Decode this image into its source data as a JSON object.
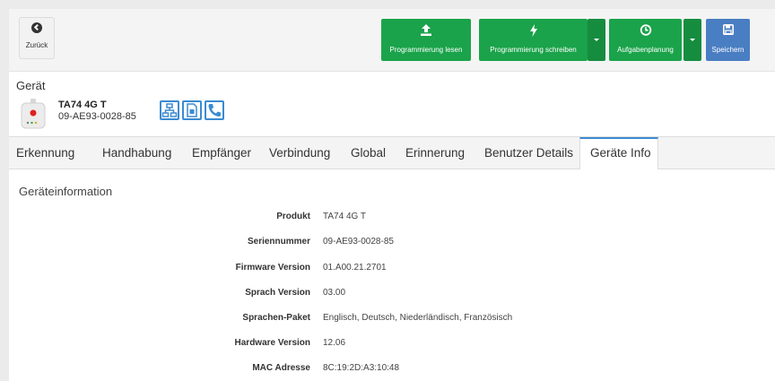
{
  "toolbar": {
    "back_label": "Zurück",
    "read_label": "Programmierung lesen",
    "write_label": "Programmierung schreiben",
    "schedule_label": "Aufgabenplanung",
    "save_label": "Speichern",
    "colors": {
      "green": "#1aa34a",
      "blue": "#4a7ec2"
    }
  },
  "device": {
    "heading": "Gerät",
    "name": "TA74 4G T",
    "serial": "09-AE93-0028-85",
    "icons": [
      "network-icon",
      "sim-card-icon",
      "phone-icon"
    ]
  },
  "tabs": [
    {
      "label": "Erkennung"
    },
    {
      "label": "Handhabung"
    },
    {
      "label": "Empfänger"
    },
    {
      "label": "Verbindung"
    },
    {
      "label": "Global"
    },
    {
      "label": "Erinnerung"
    },
    {
      "label": "Benutzer Details"
    },
    {
      "label": "Geräte Info",
      "active": true
    }
  ],
  "info": {
    "title": "Geräteinformation",
    "rows": [
      {
        "key": "Produkt",
        "value": "TA74 4G T"
      },
      {
        "key": "Seriennummer",
        "value": "09-AE93-0028-85"
      },
      {
        "key": "Firmware Version",
        "value": "01.A00.21.2701"
      },
      {
        "key": "Sprach Version",
        "value": "03.00"
      },
      {
        "key": "Sprachen-Paket",
        "value": "Englisch, Deutsch, Niederländisch, Französisch"
      },
      {
        "key": "Hardware Version",
        "value": "12.06"
      },
      {
        "key": "MAC Adresse",
        "value": "8C:19:2D:A3:10:48"
      }
    ]
  }
}
